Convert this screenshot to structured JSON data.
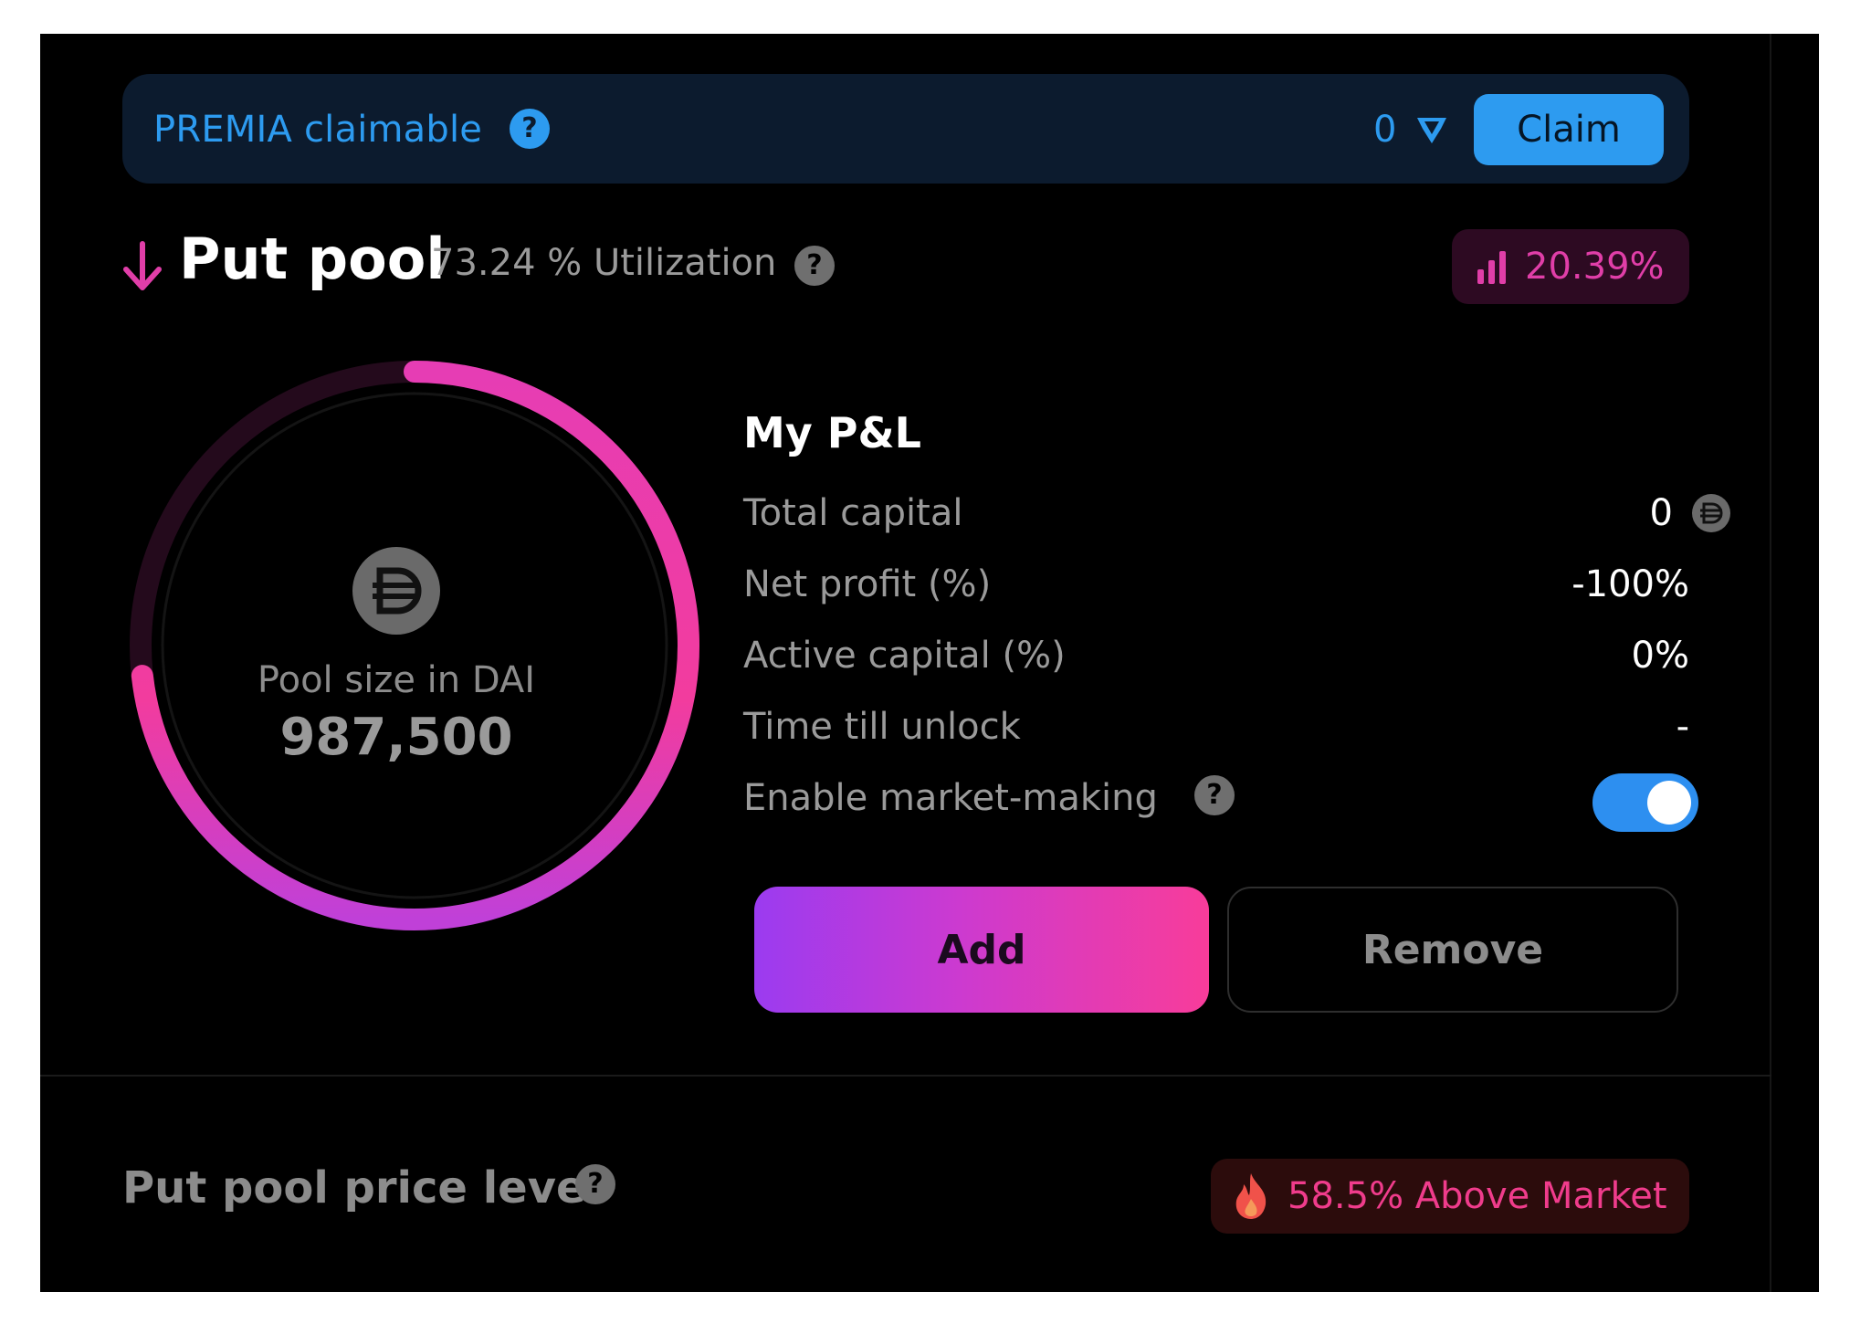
{
  "claim_bar": {
    "label": "PREMIA claimable",
    "help": "?",
    "amount": "0",
    "claim_button": "Claim",
    "accent": "#2d9bf0"
  },
  "pool": {
    "title": "Put pool",
    "utilization": "73.24 % Utilization",
    "help": "?",
    "apy": "20.39%",
    "size_label": "Pool size in DAI",
    "size_value": "987,500",
    "utilization_fraction": 0.7324,
    "icons": [
      "arrow-down-icon",
      "bar-chart-icon",
      "dai-icon"
    ]
  },
  "pnl": {
    "title": "My P&L",
    "rows": [
      {
        "label": "Total capital",
        "value": "0"
      },
      {
        "label": "Net profit (%)",
        "value": "-100%"
      },
      {
        "label": "Active capital (%)",
        "value": "0%"
      },
      {
        "label": "Time till unlock",
        "value": "-"
      }
    ],
    "market_making_label": "Enable market-making",
    "market_making_enabled": true,
    "add_button": "Add",
    "remove_button": "Remove"
  },
  "price_level": {
    "title": "Put pool price level",
    "help": "?",
    "badge": "58.5% Above Market"
  }
}
